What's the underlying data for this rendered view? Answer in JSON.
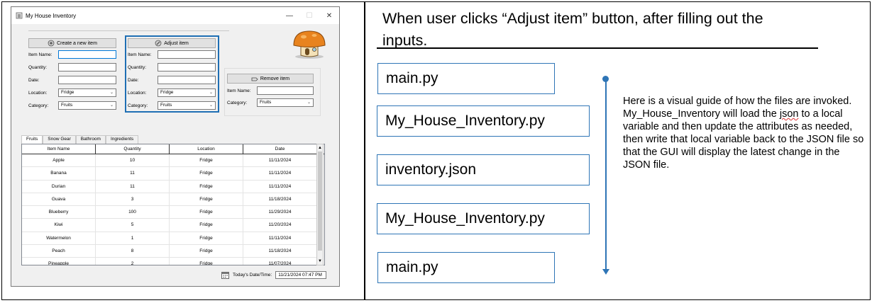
{
  "app": {
    "title": "My House Inventory",
    "window_controls": {
      "minimize": "—",
      "maximize": "☐",
      "close": "✕"
    },
    "create": {
      "button": "Create a new item",
      "item_name_label": "Item Name:",
      "quantity_label": "Quantity:",
      "date_label": "Date:",
      "location_label": "Location:",
      "location_value": "Fridge",
      "category_label": "Category:",
      "category_value": "Fruits"
    },
    "adjust": {
      "button": "Adjust item",
      "item_name_label": "Item Name:",
      "quantity_label": "Quantity:",
      "date_label": "Date:",
      "location_label": "Location:",
      "location_value": "Fridge",
      "category_label": "Category:",
      "category_value": "Fruits"
    },
    "remove": {
      "button": "Remove item",
      "item_name_label": "Item Name:",
      "category_label": "Category:",
      "category_value": "Fruits"
    },
    "tabs": [
      "Fruits",
      "Snow Gear",
      "Bathroom",
      "Ingredients"
    ],
    "columns": [
      "Item Name",
      "Quantity",
      "Location",
      "Date"
    ],
    "rows": [
      [
        "Apple",
        "10",
        "Fridge",
        "11/11/2024"
      ],
      [
        "Banana",
        "11",
        "Fridge",
        "11/11/2024"
      ],
      [
        "Durian",
        "11",
        "Fridge",
        "11/11/2024"
      ],
      [
        "Guava",
        "3",
        "Fridge",
        "11/18/2024"
      ],
      [
        "Blueberry",
        "100",
        "Fridge",
        "11/29/2024"
      ],
      [
        "Kiwi",
        "5",
        "Fridge",
        "11/20/2024"
      ],
      [
        "Watermelon",
        "1",
        "Fridge",
        "11/11/2024"
      ],
      [
        "Peach",
        "8",
        "Fridge",
        "11/18/2024"
      ],
      [
        "Pineapple",
        "2",
        "Fridge",
        "11/07/2024"
      ]
    ],
    "date_time_label": "Today's Date/Time:",
    "date_time_value": "11/21/2024 07:47 PM"
  },
  "explanation": {
    "heading_line1": "When user clicks “Adjust item” button, after filling out the",
    "heading_line2": "inputs.",
    "files": [
      "main.py",
      "My_House_Inventory.py",
      "inventory.json",
      "My_House_Inventory.py",
      "main.py"
    ],
    "note_parts": {
      "before": "Here is a visual guide of how the files are invoked. My_House_Inventory will load the ",
      "flagged": "json",
      "after": " to a local variable and then update the attributes as needed, then write that local variable back to the JSON file so that the GUI will display the latest change in the JSON file."
    }
  },
  "colors": {
    "accent_blue": "#2e75b6",
    "highlight_blue": "#1f6fb4"
  }
}
